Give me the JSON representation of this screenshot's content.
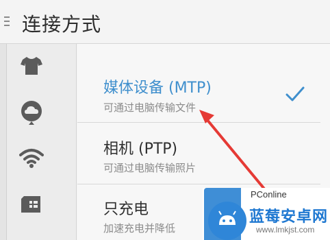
{
  "header": {
    "title": "连接方式"
  },
  "rail": {
    "items": [
      {
        "icon": "shirt-icon"
      },
      {
        "icon": "cloud-icon"
      },
      {
        "icon": "wifi-icon"
      },
      {
        "icon": "sim-card-icon"
      }
    ]
  },
  "options": [
    {
      "title": "媒体设备 (MTP)",
      "subtitle": "可通过电脑传输文件",
      "selected": true
    },
    {
      "title": "相机 (PTP)",
      "subtitle": "可通过电脑传输照片",
      "selected": false
    },
    {
      "title": "只充电",
      "subtitle": "加速充电并降低",
      "selected": false
    }
  ],
  "colors": {
    "accent": "#3f8fcd",
    "arrow": "#e53a35",
    "subtitle": "#8b8b8b"
  },
  "watermark": {
    "brand": "PConline",
    "name": "蓝莓安卓网",
    "url": "www.lmkjst.com"
  }
}
